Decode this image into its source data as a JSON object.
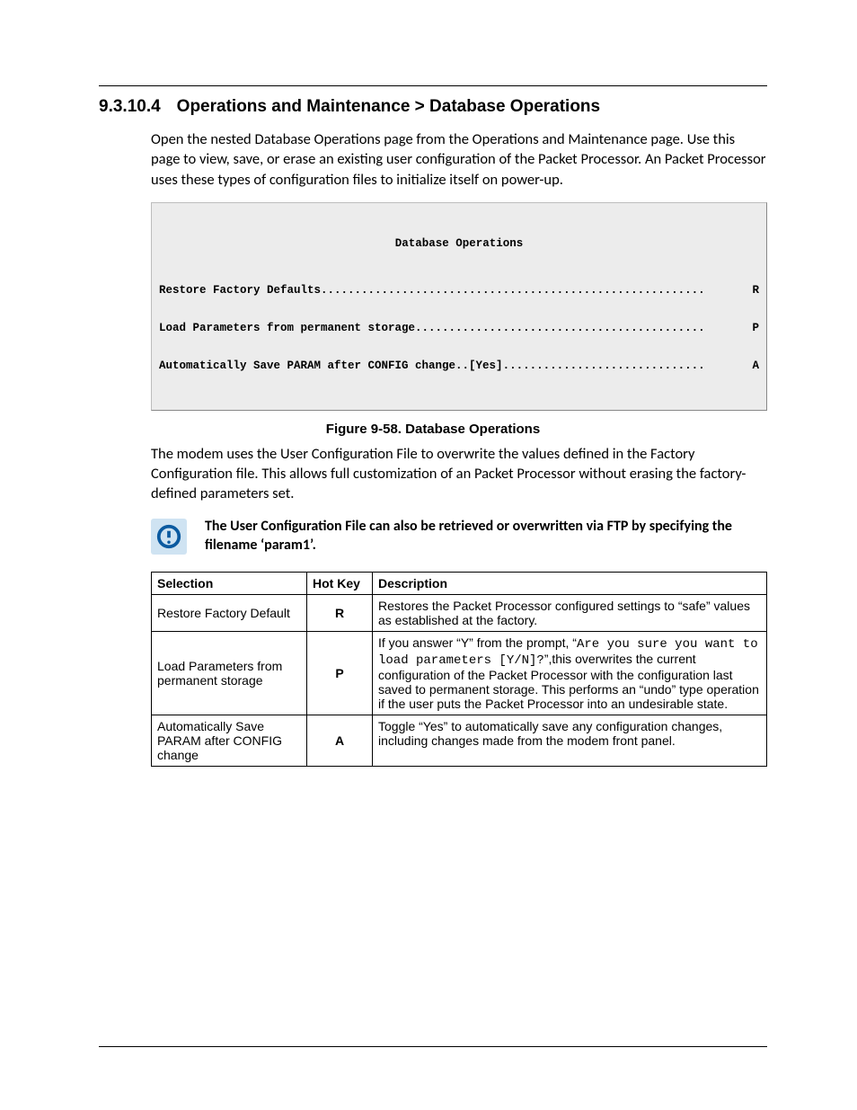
{
  "heading": {
    "number": "9.3.10.4",
    "title": "Operations and Maintenance > Database Operations"
  },
  "intro_paragraph": "Open the nested Database Operations page from the Operations and Maintenance page. Use this page to view, save, or erase an existing user configuration of the Packet Processor. An Packet Processor uses these types of configuration files to initialize itself on power-up.",
  "terminal": {
    "title": "Database Operations",
    "lines": [
      {
        "left": "Restore Factory Defaults",
        "right": "R"
      },
      {
        "left": "Load Parameters from permanent storage",
        "right": "P"
      },
      {
        "left": "Automatically Save PARAM after CONFIG change..[Yes]",
        "right": "A"
      }
    ]
  },
  "figure_caption": "Figure 9-58. Database Operations",
  "after_figure_paragraph": "The modem uses the User Configuration File to overwrite the values defined in the Factory Configuration file. This allows full customization of an Packet Processor without erasing the factory-defined parameters set.",
  "note_text": "The User Configuration File can also be retrieved or overwritten via FTP by specifying the filename ‘param1’.",
  "table": {
    "headers": {
      "selection": "Selection",
      "hotkey": "Hot Key",
      "description": "Description"
    },
    "rows": [
      {
        "selection": "Restore Factory Default",
        "hotkey": "R",
        "desc_pre": "Restores the Packet Processor configured settings to “safe” values as established at the factory."
      },
      {
        "selection": "Load Parameters from permanent storage",
        "hotkey": "P",
        "desc_pre": "If you answer “Y” from the prompt, “",
        "desc_code": "Are you sure you want to load parameters [Y/N]?",
        "desc_post": "”,this overwrites the current configuration of the Packet Processor with the configuration last saved to permanent storage. This performs an “undo” type operation if the user puts the Packet Processor into an undesirable state."
      },
      {
        "selection": "Automatically Save PARAM after CONFIG change",
        "hotkey": "A",
        "desc_pre": "Toggle “Yes” to automatically save any configuration changes, including changes made from the modem front panel."
      }
    ]
  }
}
